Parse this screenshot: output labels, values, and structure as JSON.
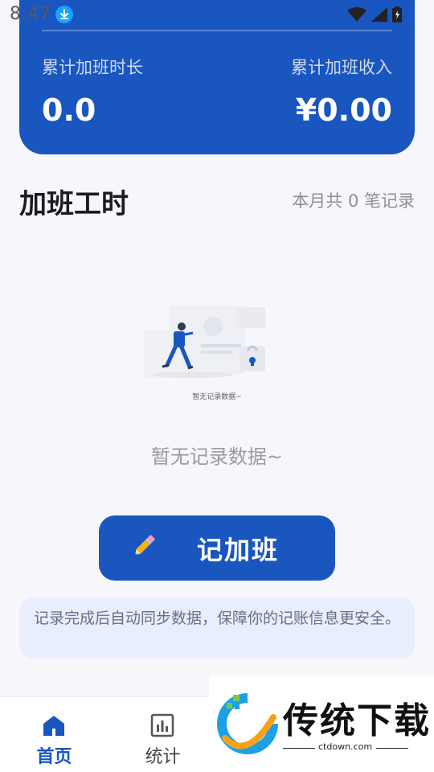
{
  "status_bar": {
    "time": "8:47"
  },
  "summary": {
    "hours_label": "累计加班时长",
    "hours_value": "0.0",
    "income_label": "累计加班收入",
    "income_value": "¥0.00"
  },
  "section": {
    "title": "加班工时",
    "meta": "本月共 0 笔记录"
  },
  "empty_state": {
    "caption": "暂无记录数据~",
    "message": "暂无记录数据~"
  },
  "record_button": {
    "icon": "pencil-icon",
    "label": "记加班"
  },
  "info_note": {
    "text": "记录完成后自动同步数据，保障你的记账信息更安全。"
  },
  "bottom_nav": {
    "items": [
      {
        "label": "首页",
        "icon": "home-icon",
        "active": true
      },
      {
        "label": "统计",
        "icon": "chart-icon",
        "active": false
      }
    ]
  },
  "watermark": {
    "brand": "传统下载",
    "url": "ctdown.com"
  },
  "colors": {
    "primary": "#1a56c0",
    "note_bg": "#e8eefb",
    "muted_text": "#9a9aa6"
  }
}
